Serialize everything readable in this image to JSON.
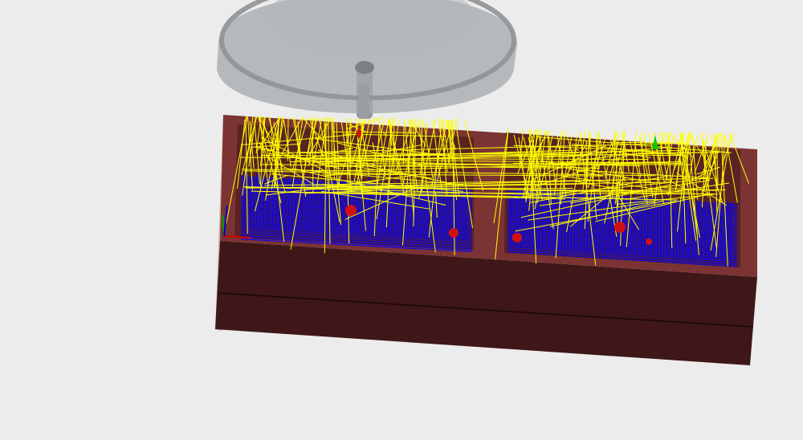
{
  "viewport": {
    "background": "#ececec",
    "view": "3d-cam-toolpath-simulation"
  },
  "scene": {
    "tool_holder": {
      "color": "#a7abad",
      "rim_color": "#8f9497"
    },
    "tool_spindle": {
      "color": "#8c9092"
    },
    "workpiece": {
      "top_color": "#7c3333",
      "front_color": "#3f1718",
      "side_color": "#c9b9a6",
      "pocket_floor_color": "#6a2a2a"
    },
    "pockets": [
      "left-pocket",
      "right-pocket"
    ],
    "toolpaths": {
      "rapid_move_color": "#ffff00",
      "cutting_move_color": "#0000ff",
      "plunge_marker_color": "#d11111",
      "start_marker_color": "#00cc00"
    },
    "axis_triad": {
      "x_color": "#d00000",
      "y_color": "#00a000",
      "z_color": "#0000d0"
    }
  }
}
